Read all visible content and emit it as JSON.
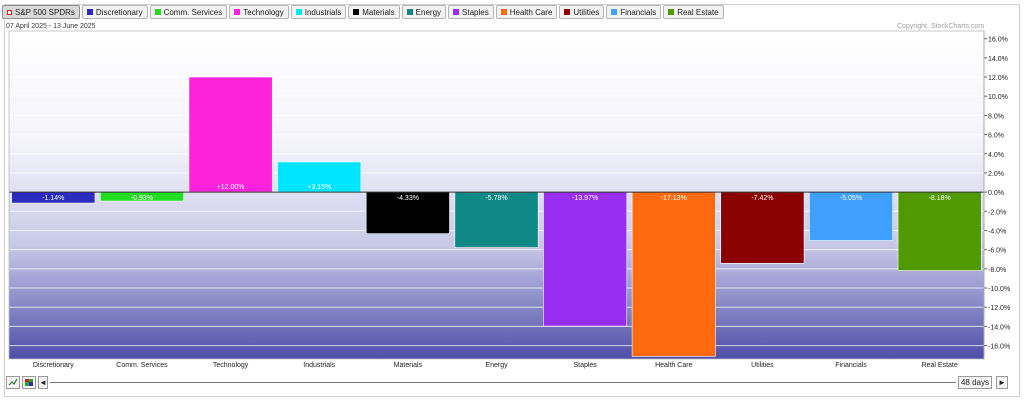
{
  "legend": [
    {
      "label": "S&P 500 SPDRs",
      "color": "#cc2222",
      "hollow": true,
      "active": true
    },
    {
      "label": "Discretionary",
      "color": "#2b2bbf"
    },
    {
      "label": "Comm. Services",
      "color": "#22dd22"
    },
    {
      "label": "Technology",
      "color": "#ff22dd"
    },
    {
      "label": "Industrials",
      "color": "#00e5ff"
    },
    {
      "label": "Materials",
      "color": "#000000"
    },
    {
      "label": "Energy",
      "color": "#118888"
    },
    {
      "label": "Staples",
      "color": "#9a2ef0"
    },
    {
      "label": "Health Care",
      "color": "#ff6a10"
    },
    {
      "label": "Utilities",
      "color": "#8b0000"
    },
    {
      "label": "Financials",
      "color": "#3fa0ff"
    },
    {
      "label": "Real Estate",
      "color": "#4f9a00"
    }
  ],
  "date_range": "07 April 2025 - 13 June 2025",
  "copyright": "Copyright, StockCharts.com",
  "controls": {
    "period_label": "48 days",
    "prev_glyph": "◄",
    "next_glyph": "►"
  },
  "chart_data": {
    "type": "bar",
    "categories": [
      "Discretionary",
      "Comm. Services",
      "Technology",
      "Industrials",
      "Materials",
      "Energy",
      "Staples",
      "Health Care",
      "Utilities",
      "Financials",
      "Real Estate"
    ],
    "values": [
      -1.14,
      -0.93,
      12.0,
      3.15,
      -4.33,
      -5.78,
      -13.97,
      -17.13,
      -7.42,
      -5.05,
      -8.18
    ],
    "data_labels": [
      "-1.14%",
      "-0.93%",
      "+12.00%",
      "+3.15%",
      "-4.33%",
      "-5.78%",
      "-13.97%",
      "-17.13%",
      "-7.42%",
      "-5.05%",
      "-8.18%"
    ],
    "colors": [
      "#2b2bbf",
      "#22dd22",
      "#ff22dd",
      "#00e5ff",
      "#000000",
      "#118888",
      "#9a2ef0",
      "#ff6a10",
      "#8b0000",
      "#3fa0ff",
      "#4f9a00"
    ],
    "ylim": [
      -17.4,
      16.8
    ],
    "yticks": [
      16,
      14,
      12,
      10,
      8,
      6,
      4,
      2,
      0,
      -2,
      -4,
      -6,
      -8,
      -10,
      -12,
      -14,
      -16
    ],
    "ytick_labels": [
      "16.0%",
      "14.0%",
      "12.0%",
      "10.0%",
      "8.0%",
      "6.0%",
      "4.0%",
      "2.0%",
      "0.0%",
      "-2.0%",
      "-4.0%",
      "-6.0%",
      "-8.0%",
      "-10.0%",
      "-12.0%",
      "-14.0%",
      "-16.0%"
    ],
    "y_axis_position": "right",
    "grid": true
  }
}
